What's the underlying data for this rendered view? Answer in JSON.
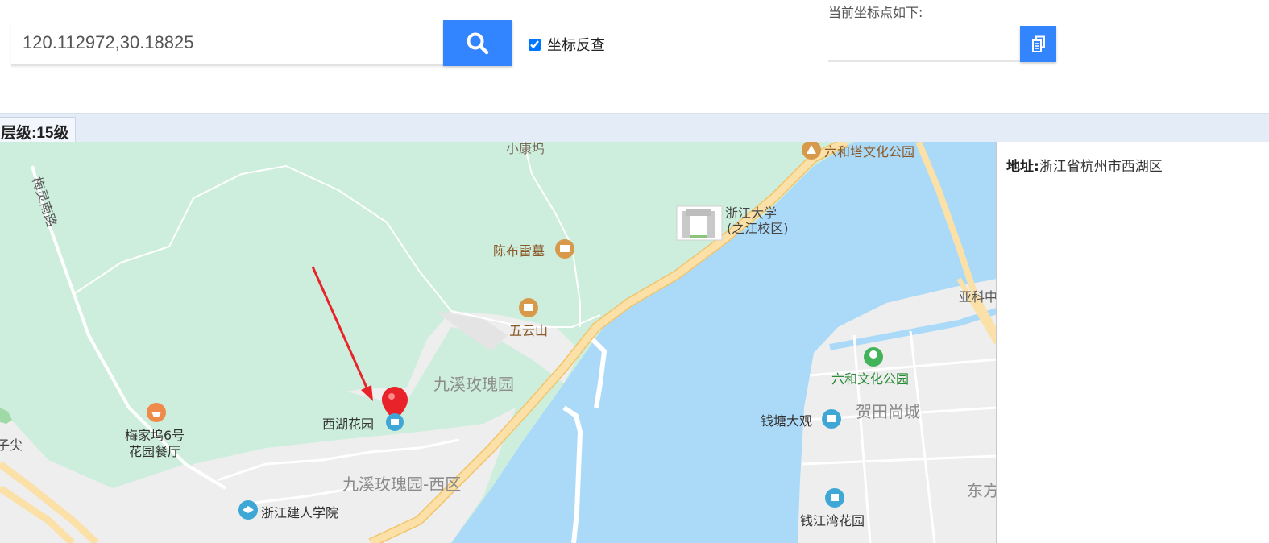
{
  "search": {
    "value": "120.112972,30.18825"
  },
  "reverse_lookup": {
    "label": "坐标反查",
    "checked": true
  },
  "coordinate": {
    "title": "当前坐标点如下:",
    "value": ""
  },
  "zoom": {
    "label": "层级:",
    "value": "15级"
  },
  "info": {
    "address_label": "地址:",
    "address_value": "浙江省杭州市西湖区"
  },
  "map": {
    "colors": {
      "water": "#abdaf8",
      "green": "#cdeedd",
      "urban": "#eeeeee",
      "road_major": "#fbe0a8",
      "marker": "#e8242a",
      "arrow": "#e8242a"
    },
    "labels": {
      "xiaokangwu": "小康坞",
      "meiling_road": "梅灵南路",
      "liuhe_pagoda_park": "六和塔文化公园",
      "zju_line1": "浙江大学",
      "zju_line2": "(之江校区)",
      "chenbulei_tomb": "陈布雷墓",
      "wuyunshan": "五云山",
      "yake": "亚科中",
      "liuhe_culture_park": "六和文化公园",
      "jiuxi_rose": "九溪玫瑰园",
      "hetian": "贺田尚城",
      "xihu_garden": "西湖花园",
      "qiantang_daguan": "钱塘大观",
      "meijiawu_line1": "梅家坞6号",
      "meijiawu_line2": "花园餐厅",
      "jian": "子尖",
      "jiuxi_rose_west": "九溪玫瑰园-西区",
      "dongfang": "东方",
      "zhejiang_jianren": "浙江建人学院",
      "qianjiang_bay": "钱江湾花园"
    }
  }
}
